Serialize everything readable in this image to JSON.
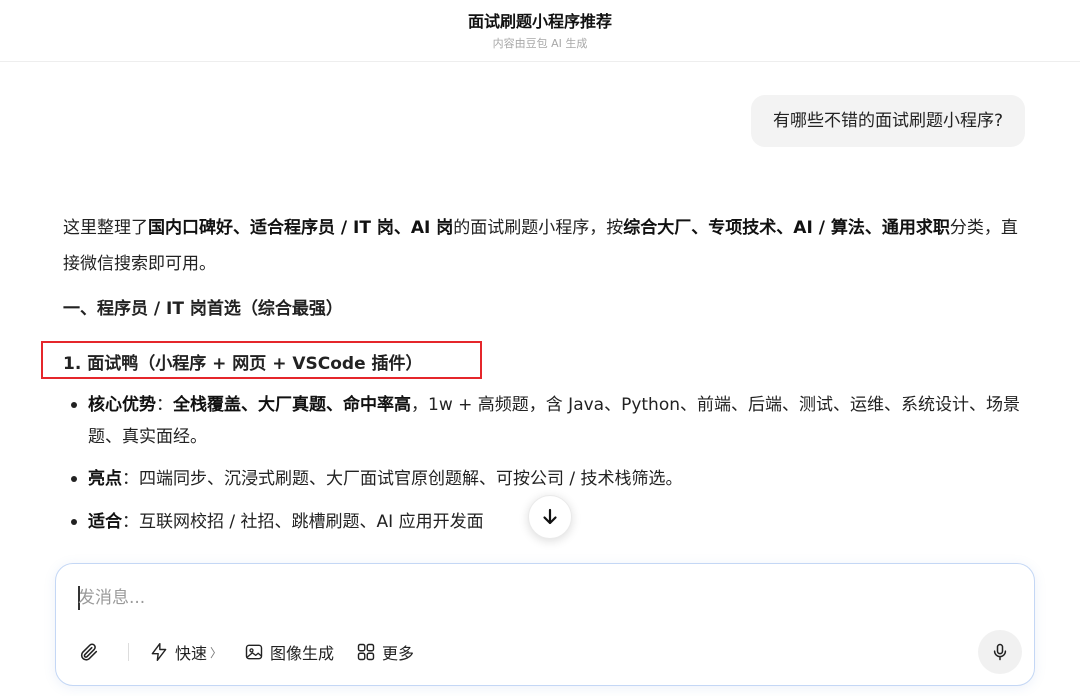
{
  "header": {
    "title": "面试刷题小程序推荐",
    "subtitle": "内容由豆包 AI 生成"
  },
  "user_message": "有哪些不错的面试刷题小程序?",
  "answer": {
    "intro": {
      "t1": "这里整理了",
      "b1": "国内口碑好、适合程序员 / IT 岗、AI 岗",
      "t2": "的面试刷题小程序，按",
      "b2": "综合大厂、专项技术、AI / 算法、通用求职",
      "t3": "分类，直接微信搜索即可用。"
    },
    "section_title": "一、程序员 / IT 岗首选（综合最强）",
    "item_title": "1. 面试鸭（小程序 + 网页 + VSCode 插件）",
    "bullets": [
      {
        "label": "核心优势",
        "sep": "：",
        "bold": "全栈覆盖、大厂真题、命中率高",
        "text": "，1w + 高频题，含 Java、Python、前端、后端、测试、运维、系统设计、场景题、真实面经。"
      },
      {
        "label": "亮点",
        "sep": "：",
        "bold": "",
        "text": "四端同步、沉浸式刷题、大厂面试官原创题解、可按公司 / 技术栈筛选。"
      },
      {
        "label": "适合",
        "sep": "：",
        "bold": "",
        "text": "互联网校招 / 社招、跳槽刷题、AI 应用开发面"
      }
    ]
  },
  "composer": {
    "placeholder": "发消息...",
    "tools": {
      "fast": "快速",
      "fast_chevron": "〉",
      "image_gen": "图像生成",
      "more": "更多"
    }
  },
  "colors": {
    "highlight_border": "#e5262b",
    "composer_border": "#c4d7f5"
  }
}
